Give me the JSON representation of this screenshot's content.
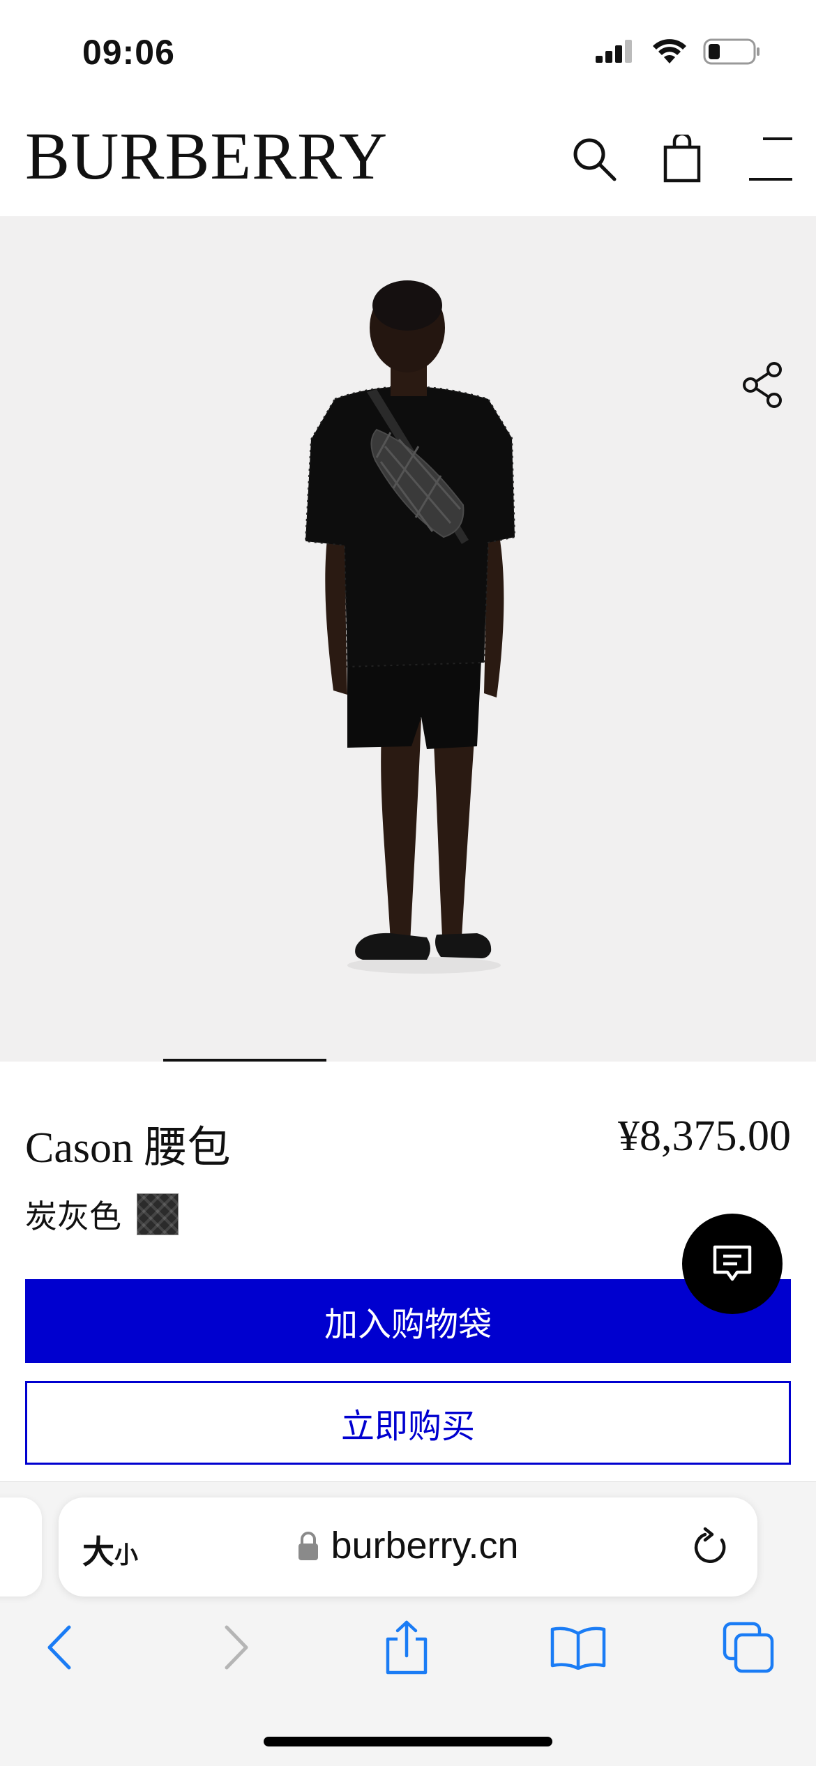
{
  "status_bar": {
    "time": "09:06"
  },
  "header": {
    "logo": "BURBERRY"
  },
  "product": {
    "title": "Cason 腰包",
    "price": "¥8,375.00",
    "color_name": "炭灰色",
    "add_to_bag_label": "加入购物袋",
    "buy_now_label": "立即购买"
  },
  "browser": {
    "text_size_label_big": "大",
    "text_size_label_small": "小",
    "url": "burberry.cn"
  },
  "colors": {
    "accent": "#0000cf",
    "hero_bg": "#f1f0f0",
    "swatch": "#2b2b2b"
  },
  "icons": [
    "signal-icon",
    "wifi-icon",
    "battery-icon",
    "search-icon",
    "shopping-bag-icon",
    "menu-icon",
    "share-icon",
    "chat-icon",
    "lock-icon",
    "reload-icon",
    "back-icon",
    "forward-icon",
    "share-sheet-icon",
    "bookmarks-icon",
    "tabs-icon"
  ]
}
